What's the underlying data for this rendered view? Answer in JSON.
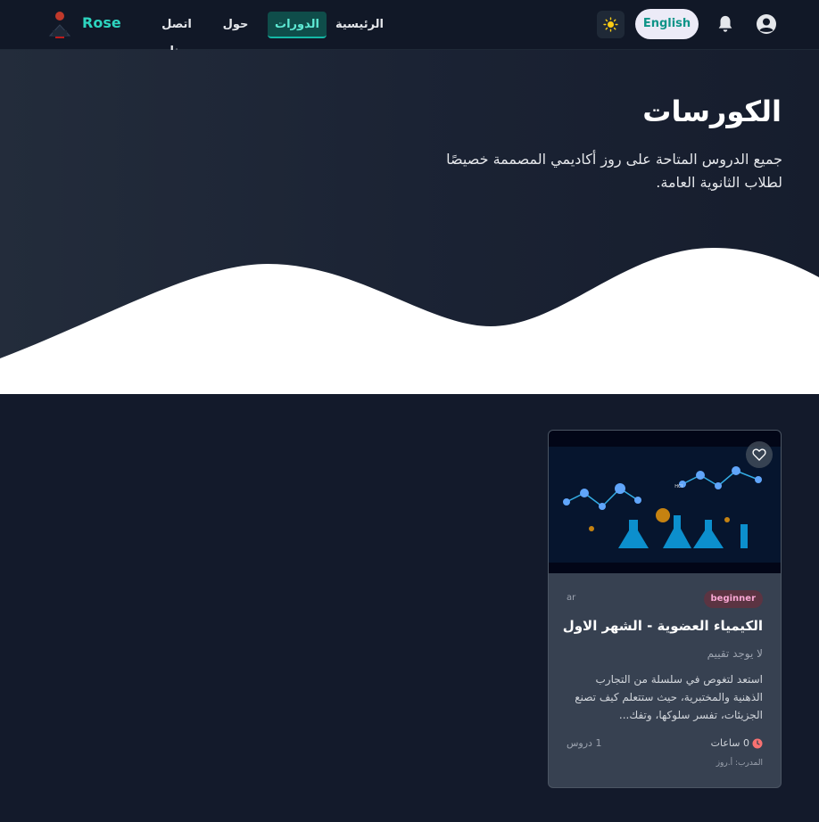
{
  "navbar": {
    "brand": "Rose",
    "links": [
      "الرئيسية",
      "الدورات",
      "حول",
      "اتصل بنا"
    ],
    "active_link": "الدورات",
    "lang_toggle": "English",
    "icons": [
      "logo",
      "sun-icon",
      "bell-icon",
      "user-icon"
    ]
  },
  "hero": {
    "title": "الكورسات",
    "subtitle": "جميع الدروس المتاحة على روز أكاديمي المصممة خصيصًا لطلاب الثانوية العامة."
  },
  "course": {
    "level": "beginner",
    "language": "ar",
    "title": "الكيمياء العضوية - الشهر الاول",
    "rating": "لا يوجد تقييم",
    "description": "استعد لتغوص في سلسلة من التجارب الذهنية والمختبرية، حيث ستتعلم كيف تصنع الجزيئات، تفسر سلوكها، وتفك...",
    "hours": "0 ساعات",
    "lessons": "1 دروس",
    "instructor": "المدرب: أ.روز"
  },
  "colors": {
    "accent": "#14b8a6",
    "page_bg": "#131a2b",
    "card_bg": "#374151",
    "badge_bg": "#5b3442",
    "clock": "#f87171"
  }
}
